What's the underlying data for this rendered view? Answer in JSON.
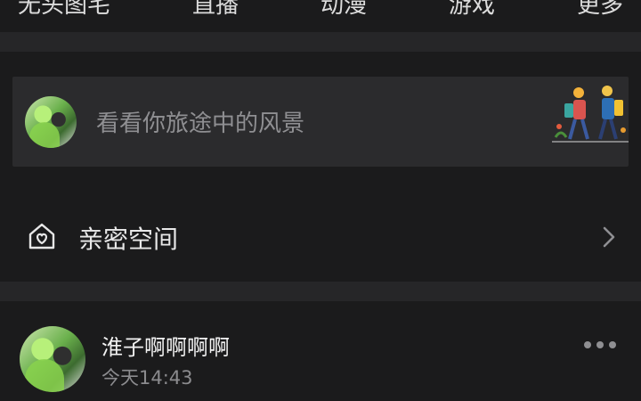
{
  "top_nav": {
    "items": [
      "无头图宅",
      "直播",
      "动漫",
      "游戏",
      "更多"
    ]
  },
  "story_prompt": {
    "text": "看看你旅途中的风景"
  },
  "intimate_space": {
    "label": "亲密空间"
  },
  "post": {
    "author": "淮子啊啊啊啊",
    "time": "今天14:43"
  },
  "colors": {
    "background": "#1b1b1c",
    "card": "#2b2b2d",
    "separator": "#262628",
    "muted_text": "#8f8f92"
  },
  "icons": {
    "intimate_space": "heart-home-icon",
    "chevron": "chevron-right-icon",
    "more": "more-dots-icon"
  }
}
